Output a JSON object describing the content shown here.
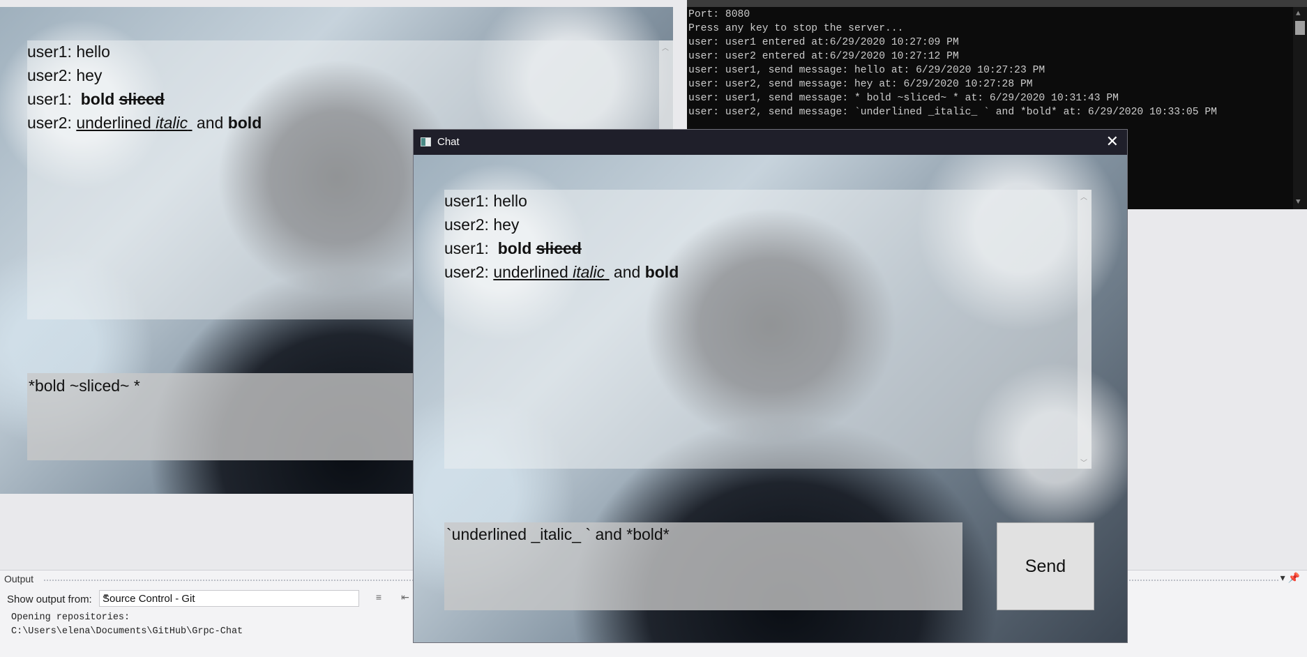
{
  "console": {
    "lines": [
      "Port: 8080",
      "Press any key to stop the server...",
      "user: user1 entered at:6/29/2020 10:27:09 PM",
      "user: user2 entered at:6/29/2020 10:27:12 PM",
      "user: user1, send message: hello at: 6/29/2020 10:27:23 PM",
      "user: user2, send message: hey at: 6/29/2020 10:27:28 PM",
      "user: user1, send message: * bold ~sliced~ * at: 6/29/2020 10:31:43 PM",
      "user: user2, send message: `underlined _italic_ ` and *bold* at: 6/29/2020 10:33:05 PM"
    ]
  },
  "output": {
    "title": "Output",
    "show_from_label": "Show output from:",
    "source_selected": "Source Control - Git",
    "messages": "Opening repositories:\nC:\\Users\\elena\\Documents\\GitHub\\Grpc-Chat"
  },
  "chat": {
    "window_title": "Chat",
    "messages": [
      {
        "prefix": "user1: hello"
      },
      {
        "prefix": "user2: hey"
      },
      {
        "prefix": "user1: ",
        "bold": "bold",
        "struck": "sliced"
      },
      {
        "prefix": "user2: ",
        "underlined": "underlined ",
        "italic": "italic",
        "after": " and ",
        "bold": "bold"
      }
    ],
    "back_input_value": "*bold ~sliced~ *",
    "front_input_value": "`underlined _italic_ ` and *bold*",
    "send_label": "Send",
    "close_glyph": "✕"
  }
}
